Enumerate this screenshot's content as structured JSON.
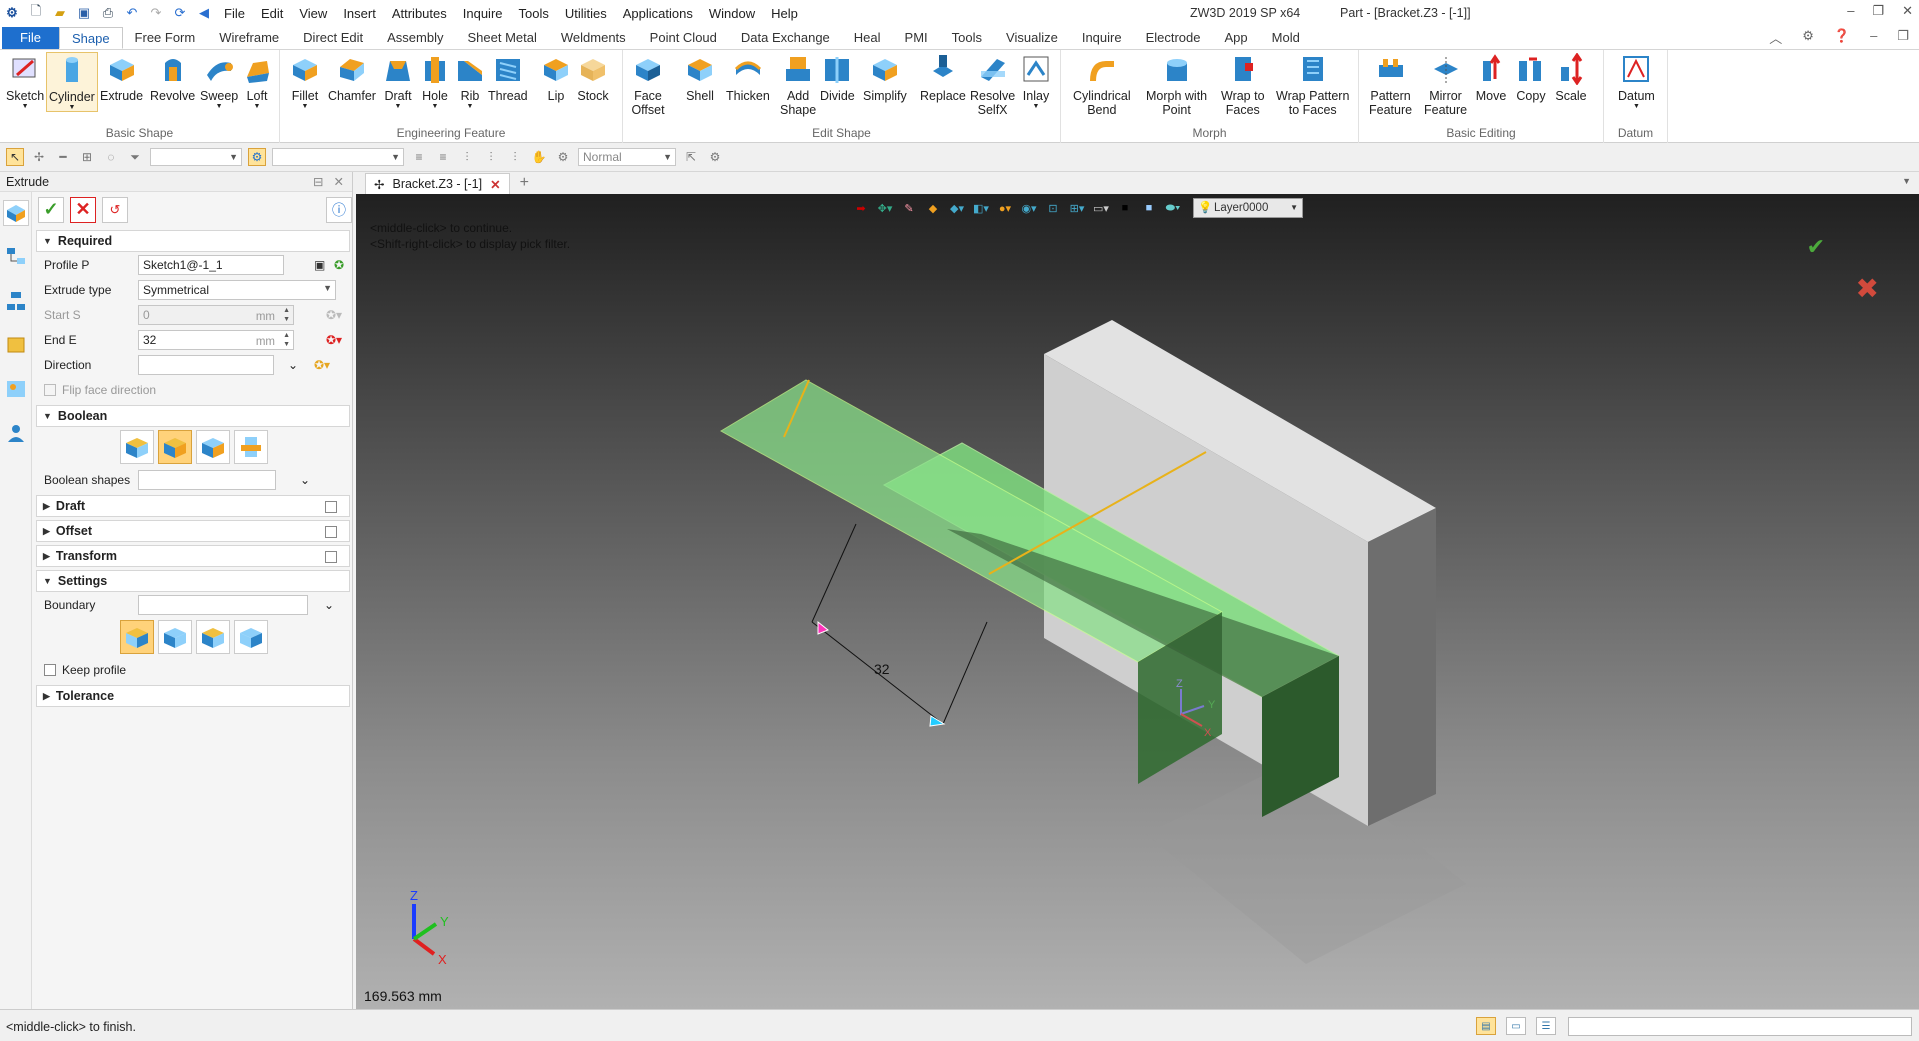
{
  "app": {
    "title": "ZW3D 2019 SP x64",
    "doc_title": "Part - [Bracket.Z3 - [-1]]"
  },
  "menu": [
    "File",
    "Edit",
    "View",
    "Insert",
    "Attributes",
    "Inquire",
    "Tools",
    "Utilities",
    "Applications",
    "Window",
    "Help"
  ],
  "tabs": [
    "File",
    "Shape",
    "Free Form",
    "Wireframe",
    "Direct Edit",
    "Assembly",
    "Sheet Metal",
    "Weldments",
    "Point Cloud",
    "Data Exchange",
    "Heal",
    "PMI",
    "Tools",
    "Visualize",
    "Inquire",
    "Electrode",
    "App",
    "Mold"
  ],
  "active_tab": "Shape",
  "ribbon": {
    "basic_shape": {
      "label": "Basic Shape",
      "items": [
        "Sketch",
        "Cylinder",
        "Extrude",
        "Revolve",
        "Sweep",
        "Loft"
      ]
    },
    "engineering": {
      "label": "Engineering Feature",
      "items": [
        "Fillet",
        "Chamfer",
        "Draft",
        "Hole",
        "Rib",
        "Thread",
        "Lip",
        "Stock"
      ]
    },
    "edit_shape": {
      "label": "Edit Shape",
      "items": [
        "Face\nOffset",
        "Shell",
        "Thicken",
        "Add\nShape",
        "Divide",
        "Simplify",
        "Replace",
        "Resolve\nSelfX",
        "Inlay"
      ]
    },
    "morph": {
      "label": "Morph",
      "items": [
        "Cylindrical\nBend",
        "Morph with\nPoint",
        "Wrap to\nFaces",
        "Wrap Pattern\nto Faces"
      ]
    },
    "basic_editing": {
      "label": "Basic Editing",
      "items": [
        "Pattern\nFeature",
        "Mirror\nFeature",
        "Move",
        "Copy",
        "Scale"
      ]
    },
    "datum": {
      "label": "Datum",
      "items": [
        "Datum"
      ]
    }
  },
  "toolbar2": {
    "render_mode": "Normal"
  },
  "left_panel": {
    "title": "Extrude",
    "sections": {
      "required": "Required",
      "boolean": "Boolean",
      "draft": "Draft",
      "offset": "Offset",
      "transform": "Transform",
      "settings": "Settings",
      "tolerance": "Tolerance"
    },
    "fields": {
      "profile_label": "Profile P",
      "profile_value": "Sketch1@-1_1",
      "extrude_type_label": "Extrude type",
      "extrude_type_value": "Symmetrical",
      "start_label": "Start S",
      "start_value": "0",
      "start_unit": "mm",
      "end_label": "End E",
      "end_value": "32",
      "end_unit": "mm",
      "direction_label": "Direction",
      "flip_label": "Flip face direction",
      "boolean_shapes_label": "Boolean shapes",
      "boundary_label": "Boundary",
      "keep_profile_label": "Keep profile"
    }
  },
  "view": {
    "tab": "Bracket.Z3 - [-1]",
    "hint_1": "<middle-click> to continue.",
    "hint_2": "<Shift-right-click> to display pick filter.",
    "layer": "Layer0000",
    "dimension": "32",
    "measure": "169.563 mm",
    "axis_x": "X",
    "axis_y": "Y",
    "axis_z": "Z"
  },
  "status": {
    "text": "<middle-click> to finish."
  },
  "colors": {
    "accent": "#1e6fce",
    "preview_green": "#7fdc7f",
    "edge_yellow": "#e8b21a",
    "part_gray": "#d9d9d9"
  }
}
